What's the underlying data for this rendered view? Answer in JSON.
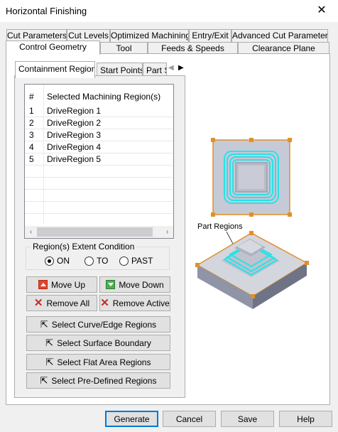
{
  "window": {
    "title": "Horizontal Finishing",
    "close_glyph": "✕"
  },
  "tabs_row1": [
    "Cut Parameters",
    "Cut Levels",
    "Optimized Machining",
    "Entry/Exit",
    "Advanced Cut Parameters"
  ],
  "tabs_row2": [
    "Control Geometry",
    "Tool",
    "Feeds & Speeds",
    "Clearance Plane"
  ],
  "active_tab": "Control Geometry",
  "subtabs": [
    "Containment Regions",
    "Start Points",
    "Part S"
  ],
  "active_subtab": "Containment Regions",
  "subtab_scroll": {
    "left": "◀",
    "right": "▶"
  },
  "regions_list": {
    "col_num": "#",
    "col_name": "Selected Machining Region(s)",
    "rows": [
      {
        "num": "1",
        "name": "DriveRegion 1"
      },
      {
        "num": "2",
        "name": "DriveRegion 2"
      },
      {
        "num": "3",
        "name": "DriveRegion 3"
      },
      {
        "num": "4",
        "name": "DriveRegion 4"
      },
      {
        "num": "5",
        "name": "DriveRegion 5"
      }
    ],
    "scroll_left": "‹",
    "scroll_right": "›"
  },
  "extent_condition": {
    "label": "Region(s) Extent Condition",
    "options": [
      "ON",
      "TO",
      "PAST"
    ],
    "selected": "ON"
  },
  "buttons": {
    "move_up": "Move Up",
    "move_down": "Move Down",
    "remove_all": "Remove All",
    "remove_active": "Remove Active",
    "select_curve": "Select Curve/Edge Regions",
    "select_surface": "Select Surface Boundary",
    "select_flat": "Select Flat Area Regions",
    "select_predefined": "Select Pre-Defined Regions"
  },
  "graphic": {
    "part_regions_label": "Part Regions"
  },
  "footer": {
    "generate": "Generate",
    "cancel": "Cancel",
    "save": "Save",
    "help": "Help"
  },
  "icons": {
    "cursor": "⇱",
    "remove": "✕"
  },
  "colors": {
    "accent": "#0078d7",
    "highlight_orange": "#e0902a",
    "toolpath_cyan": "#2ce0e8"
  }
}
